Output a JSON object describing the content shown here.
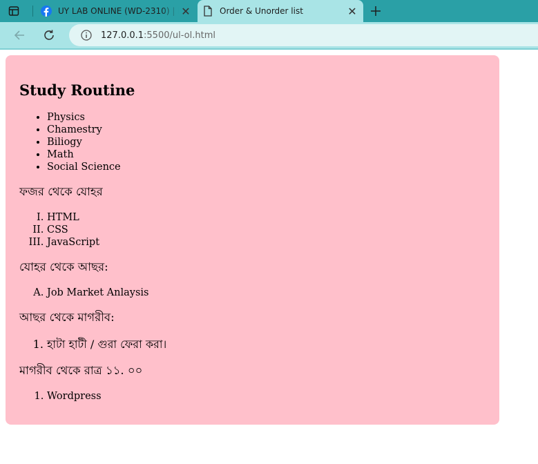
{
  "browser": {
    "tabs": [
      {
        "title": "UY LAB ONLINE (WD-2310) | Fac",
        "icon": "facebook-icon",
        "active": false
      },
      {
        "title": "Order & Unorder list",
        "icon": "document-icon",
        "active": true
      }
    ],
    "address": {
      "host": "127.0.0.1",
      "path": ":5500/ul-ol.html"
    },
    "toolbar_color": "#a9e4e6",
    "tabbar_color": "#2aa0a6"
  },
  "page": {
    "background": "#ffc0cb",
    "heading": "Study Routine",
    "subjects": [
      "Physics",
      "Chamestry",
      "Biliogy",
      "Math",
      "Social Science"
    ],
    "section1": {
      "title": "ফজর থেকে যোহর",
      "items": [
        "HTML",
        "CSS",
        "JavaScript"
      ]
    },
    "section2": {
      "title": "যোহর থেকে আছর:",
      "items": [
        "Job Market Anlaysis"
      ]
    },
    "section3": {
      "title": "আছর থেকে মাগরীব:",
      "items": [
        "হাটা হাটী / গুরা ফেরা করা।"
      ]
    },
    "section4": {
      "title": "মাগরীব থেকে রাত্র ১১. ০০",
      "items": [
        "Wordpress"
      ]
    }
  }
}
